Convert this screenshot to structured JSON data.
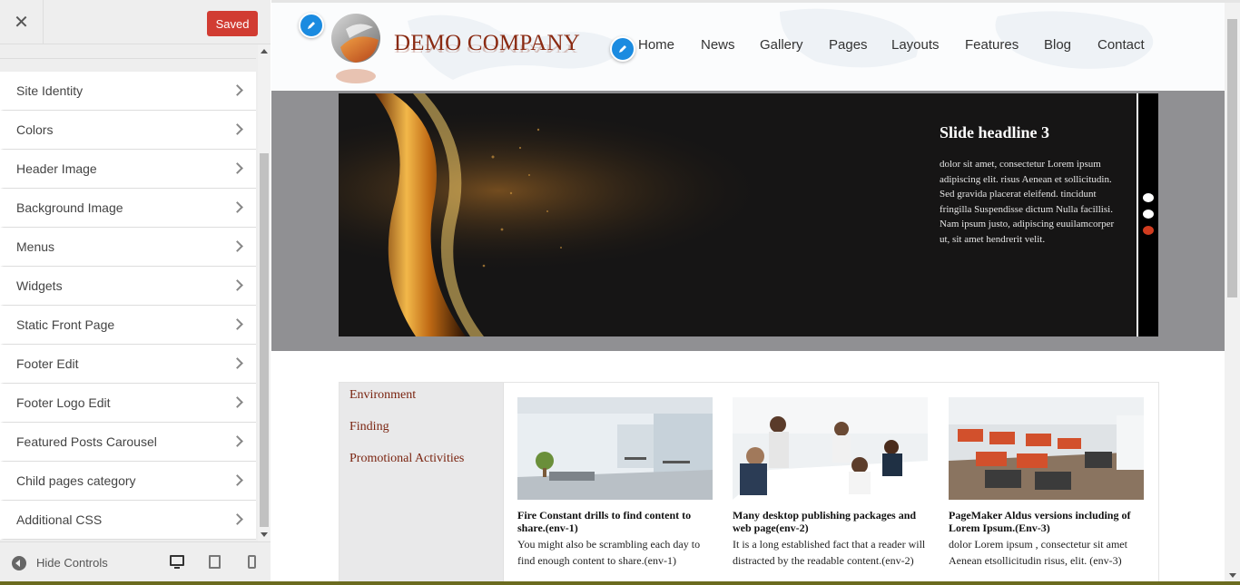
{
  "sidebar": {
    "close_icon": "close-icon",
    "saved_label": "Saved",
    "saved_color": "#d13c32",
    "items": [
      {
        "label": "Site Identity"
      },
      {
        "label": "Colors"
      },
      {
        "label": "Header Image"
      },
      {
        "label": "Background Image"
      },
      {
        "label": "Menus"
      },
      {
        "label": "Widgets"
      },
      {
        "label": "Static Front Page"
      },
      {
        "label": "Footer Edit"
      },
      {
        "label": "Footer Logo Edit"
      },
      {
        "label": "Featured Posts Carousel"
      },
      {
        "label": "Child pages category"
      },
      {
        "label": "Additional CSS"
      }
    ],
    "footer": {
      "hide_label": "Hide Controls",
      "devices": [
        "desktop-icon",
        "tablet-icon",
        "mobile-icon"
      ]
    }
  },
  "site": {
    "logo_text": "DEMO COMPANY",
    "nav": [
      "Home",
      "News",
      "Gallery",
      "Pages",
      "Layouts",
      "Features",
      "Blog",
      "Contact"
    ],
    "slide": {
      "headline": "Slide headline 3",
      "text": "dolor sit amet, consectetur Lorem ipsum adipiscing elit. risus Aenean et sollicitudin. Sed gravida placerat eleifend. tincidunt fringilla Suspendisse dictum Nulla facillisi. Nam ipsum justo, adipiscing euuilamcorper ut, sit amet hendrerit velit.",
      "dots": [
        "#ffffff",
        "#ffffff",
        "#d13c1f"
      ]
    },
    "categories": [
      "Environment",
      "Finding",
      "Promotional Activities"
    ],
    "posts": [
      {
        "title": "Fire Constant drills to find content to share.(env-1)",
        "text": "You might also be scrambling each day to find enough content to share.(env-1)"
      },
      {
        "title": "Many desktop publishing packages and web page(env-2)",
        "text": "It is a long established fact that a reader will distracted by the readable content.(env-2)"
      },
      {
        "title": "PageMaker Aldus versions including of Lorem Ipsum.(Env-3)",
        "text": "dolor Lorem ipsum , consectetur sit amet Aenean etsollicitudin risus, elit. (env-3)"
      }
    ]
  }
}
